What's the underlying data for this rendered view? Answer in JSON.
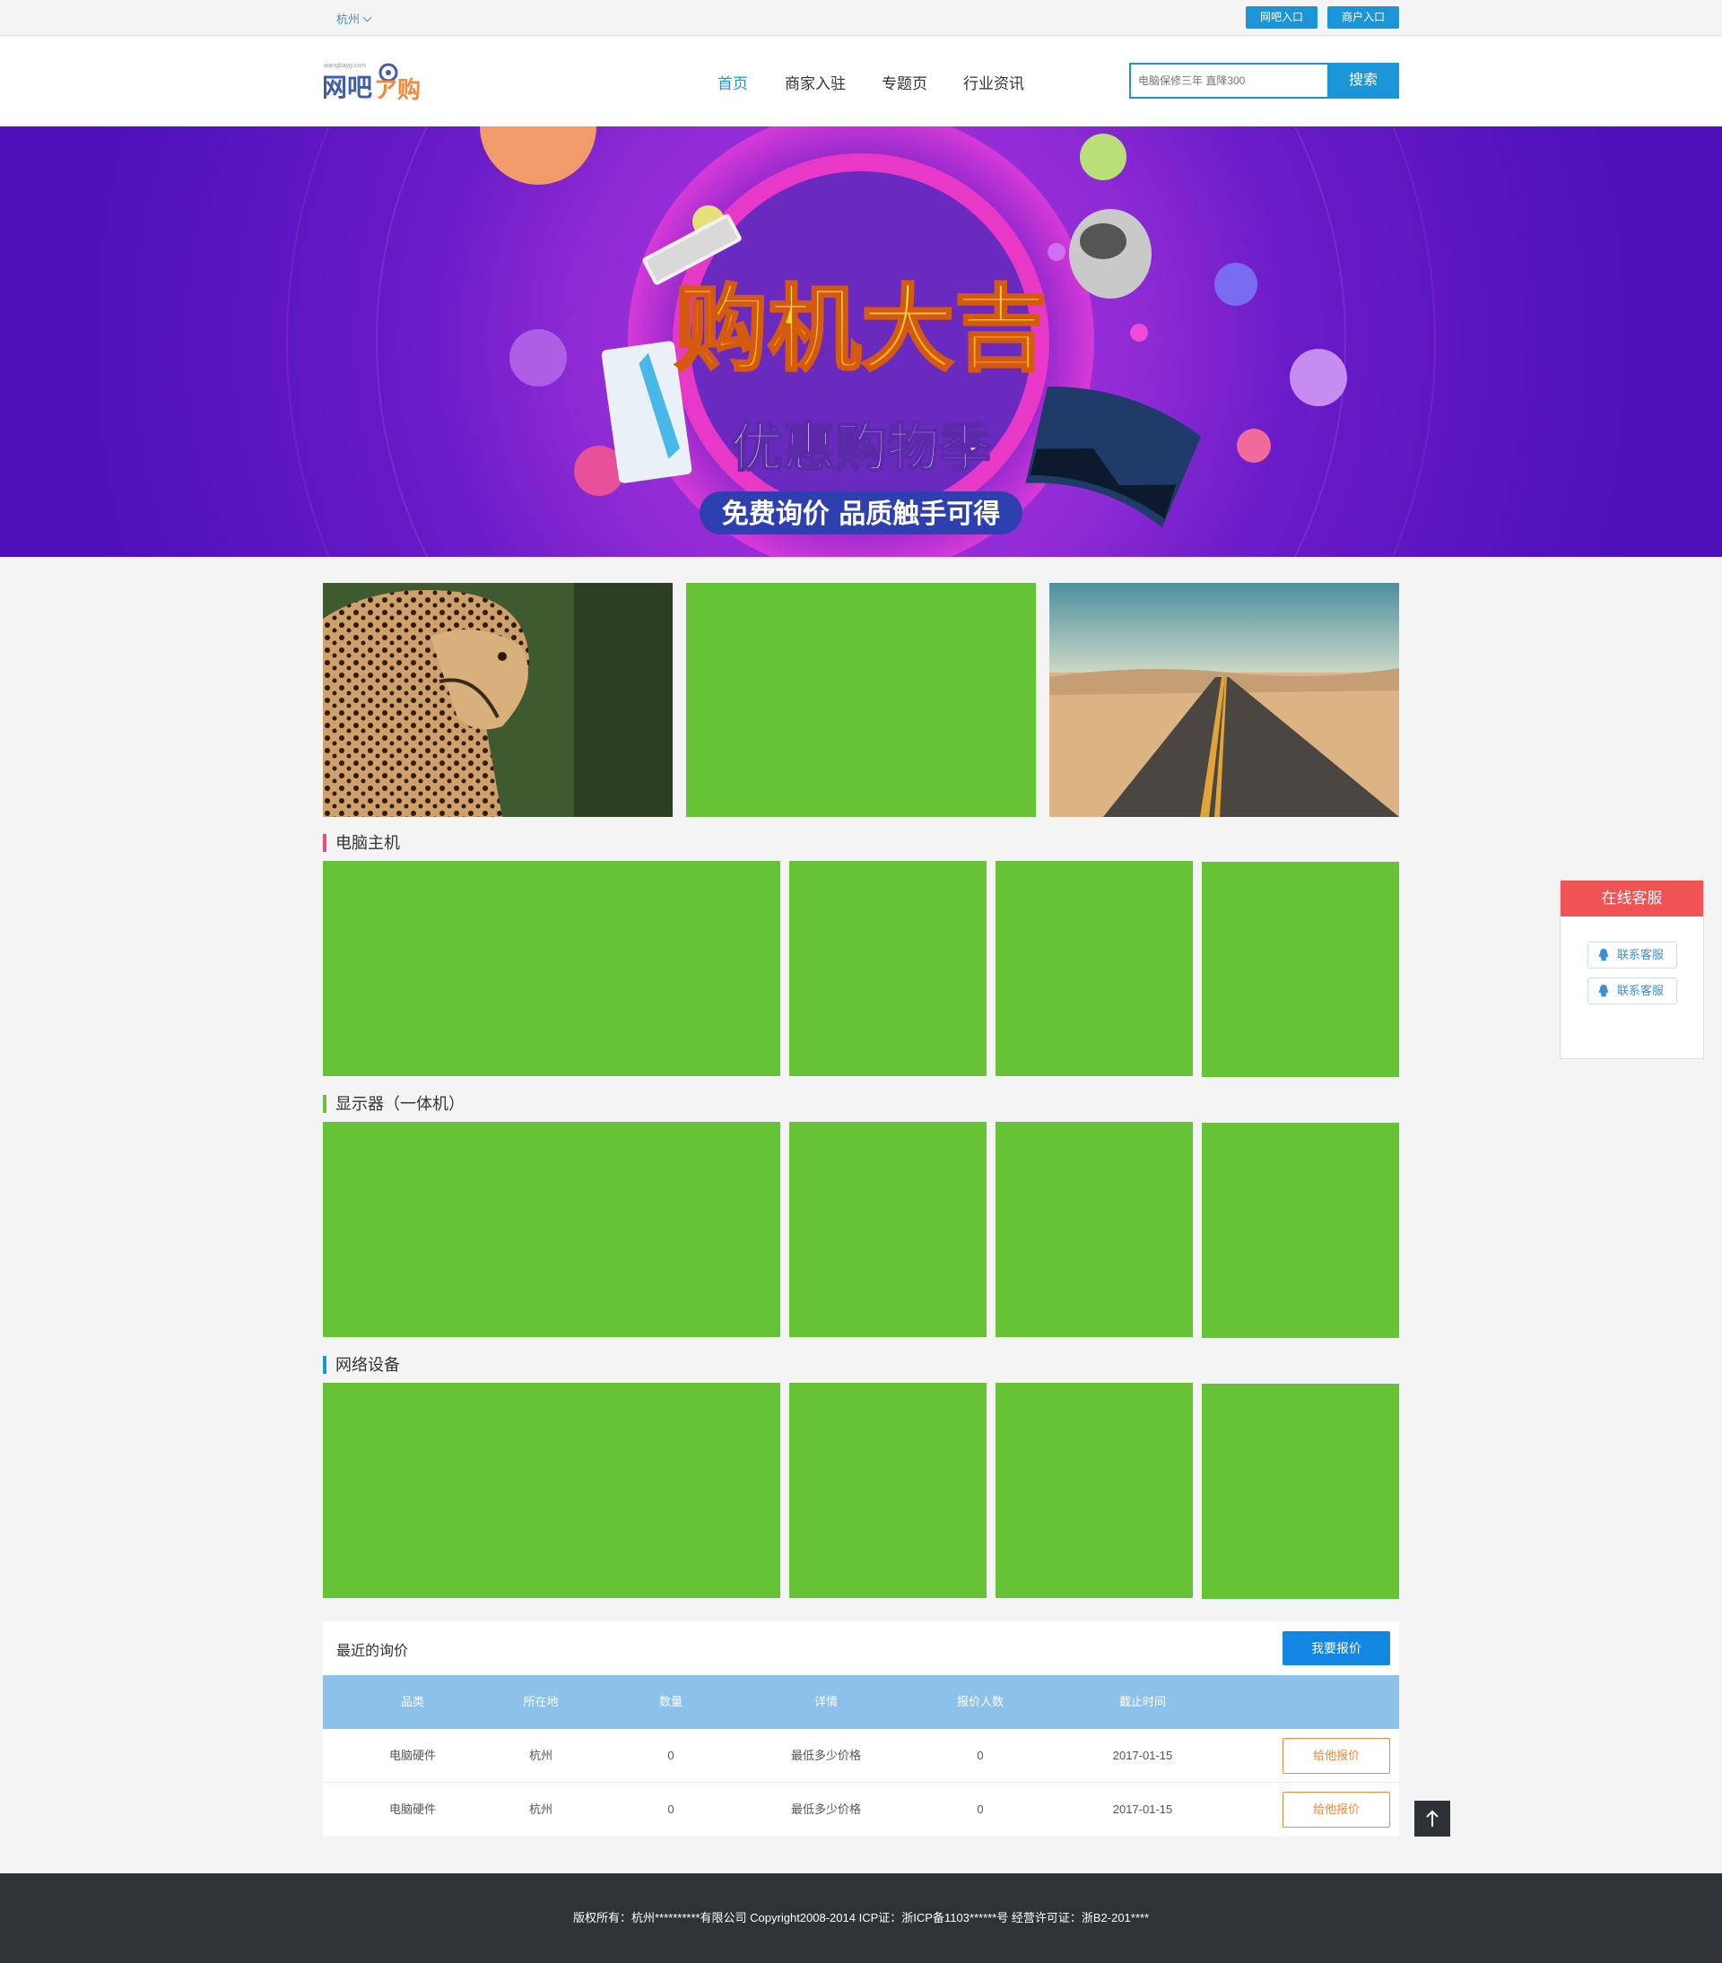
{
  "topbar": {
    "city": "杭州",
    "netbar_entry": "网吧入口",
    "merchant_entry": "商户入口"
  },
  "header": {
    "logo_text": "网吧网购",
    "logo_domain": "wangbayg.com",
    "nav": [
      "首页",
      "商家入驻",
      "专题页",
      "行业资讯"
    ],
    "search_placeholder": "电脑保修三年 直降300",
    "search_button": "搜索"
  },
  "banner": {
    "headline": "购机大吉",
    "subhead": "优惠购物季",
    "tagline": "免费询价 品质触手可得"
  },
  "sections": [
    {
      "title": "电脑主机",
      "accent": "#e8507a"
    },
    {
      "title": "显示器（一体机）",
      "accent": "#65c335"
    },
    {
      "title": "网络设备",
      "accent": "#1a96d8"
    }
  ],
  "inquiry": {
    "title": "最近的询价",
    "quote_button": "我要报价",
    "columns": [
      "品类",
      "所在地",
      "数量",
      "详情",
      "报价人数",
      "截止时间"
    ],
    "rows": [
      {
        "category": "电脑硬件",
        "location": "杭州",
        "qty": "0",
        "detail": "最低多少价格",
        "bidders": "0",
        "deadline": "2017-01-15",
        "action": "给他报价"
      },
      {
        "category": "电脑硬件",
        "location": "杭州",
        "qty": "0",
        "detail": "最低多少价格",
        "bidders": "0",
        "deadline": "2017-01-15",
        "action": "给他报价"
      }
    ]
  },
  "service": {
    "title": "在线客服",
    "buttons": [
      "联系客服",
      "联系客服"
    ]
  },
  "footer": {
    "text": "版权所有：杭州**********有限公司 Copyright2008-2014 ICP证：浙ICP备1103******号 经营许可证：浙B2-201****"
  },
  "colors": {
    "brand_blue": "#1a96d8",
    "tile_green": "#65c335",
    "service_red": "#ef5353",
    "quote_orange": "#f08a3c"
  }
}
